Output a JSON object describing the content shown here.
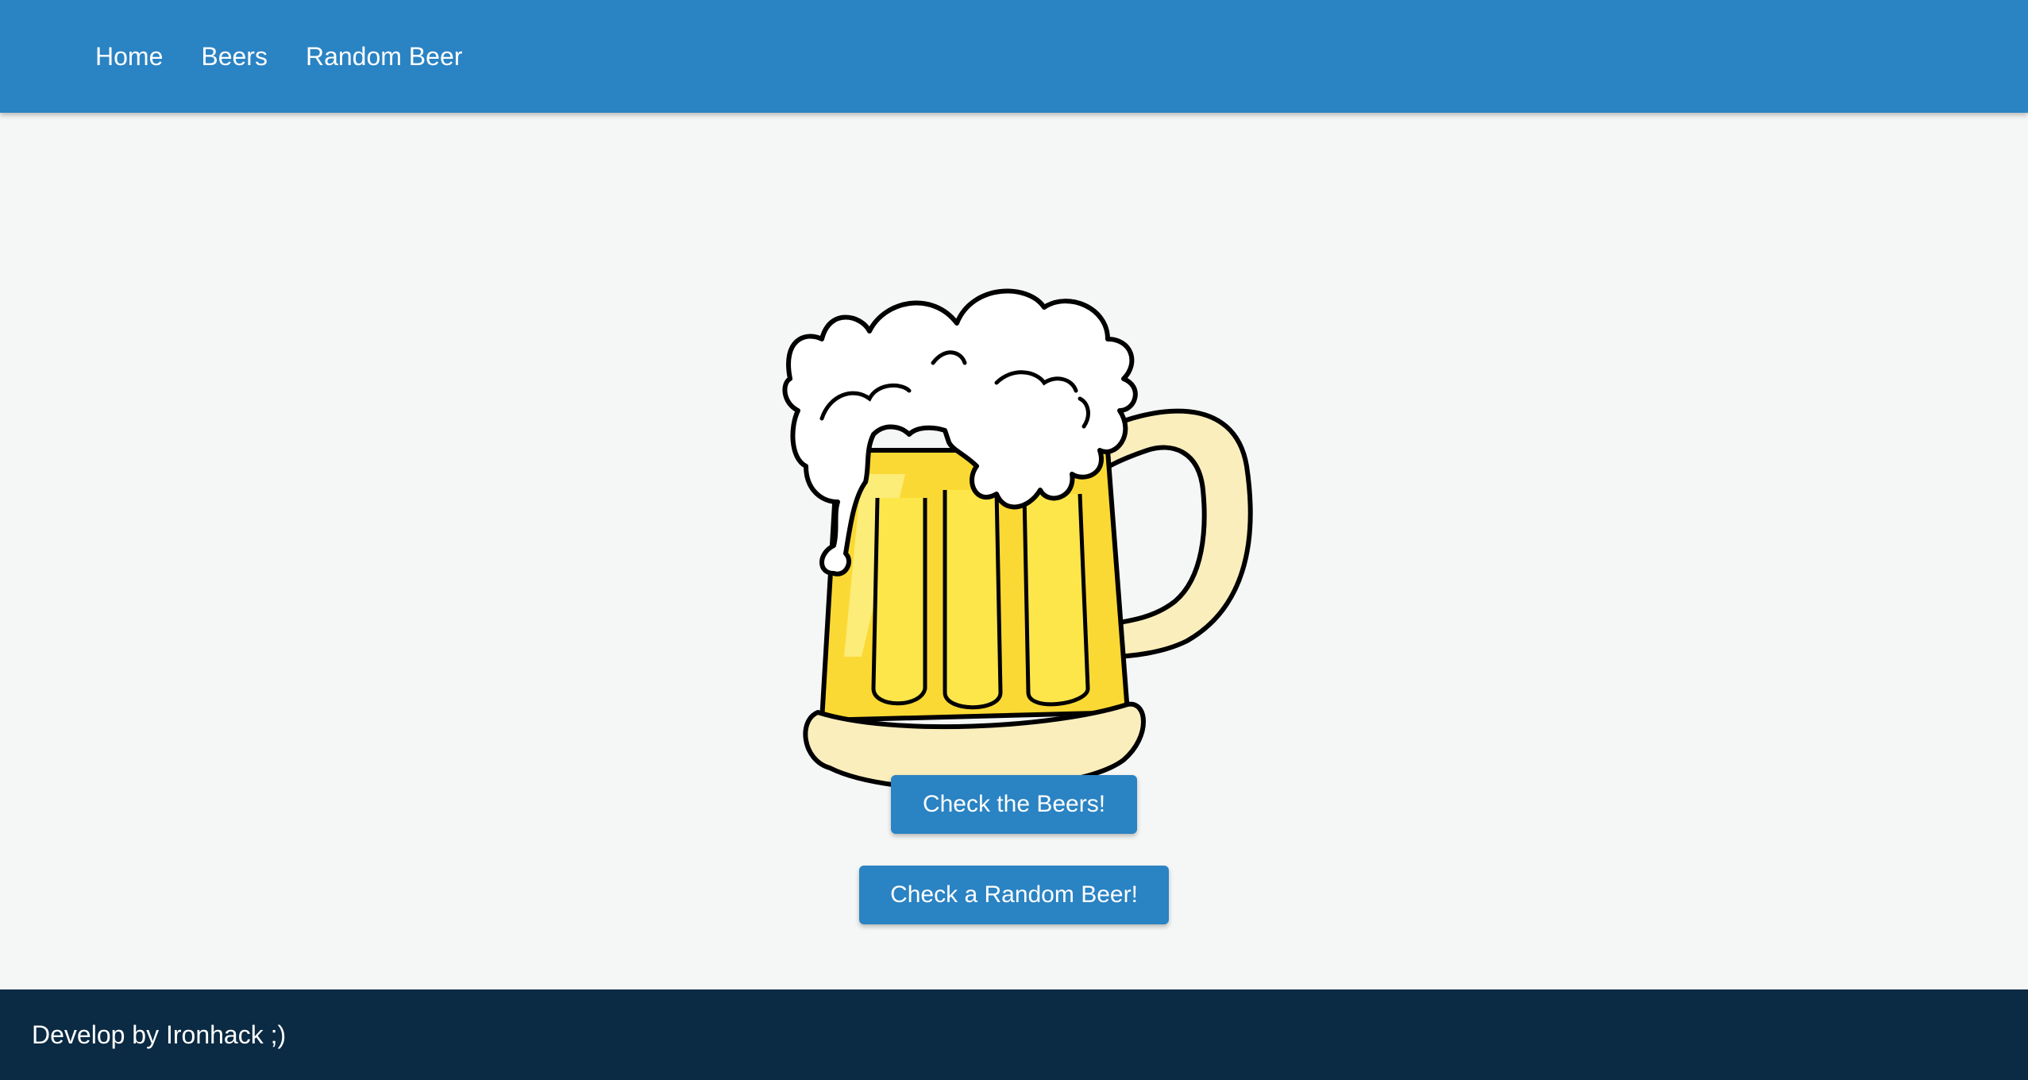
{
  "nav": {
    "items": [
      {
        "label": "Home"
      },
      {
        "label": "Beers"
      },
      {
        "label": "Random Beer"
      }
    ],
    "background": "#2a83c3"
  },
  "hero": {
    "image": "beer-mug-illustration"
  },
  "buttons": {
    "check_beers": "Check the Beers!",
    "check_random": "Check a Random Beer!"
  },
  "footer": {
    "text": "Develop by Ironhack ;)",
    "background": "#0b2a43"
  },
  "colors": {
    "page_background": "#f5f7f6",
    "beer_yellow": "#fbd934",
    "mug_cream": "#faeebd",
    "foam": "#ffffff"
  }
}
